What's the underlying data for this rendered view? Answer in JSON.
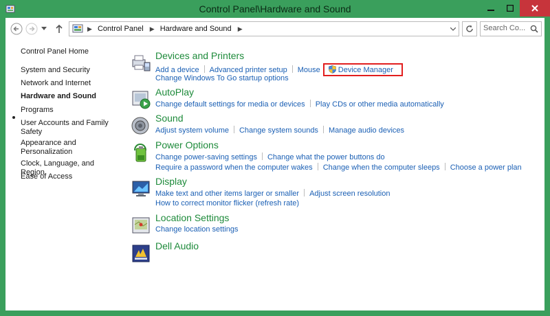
{
  "window": {
    "title": "Control Panel\\Hardware and Sound"
  },
  "address": {
    "crumbs": [
      "Control Panel",
      "Hardware and Sound"
    ]
  },
  "search": {
    "placeholder": "Search Co..."
  },
  "leftnav": {
    "home": "Control Panel Home",
    "items": [
      {
        "label": "System and Security"
      },
      {
        "label": "Network and Internet"
      },
      {
        "label": "Hardware and Sound",
        "current": true
      },
      {
        "label": "Programs"
      },
      {
        "label": "User Accounts and Family Safety"
      },
      {
        "label": "Appearance and Personalization"
      },
      {
        "label": "Clock, Language, and Region"
      },
      {
        "label": "Ease of Access"
      }
    ]
  },
  "categories": {
    "devices": {
      "title": "Devices and Printers",
      "links": [
        "Add a device",
        "Advanced printer setup",
        "Mouse",
        "Device Manager",
        "Change Windows To Go startup options"
      ]
    },
    "autoplay": {
      "title": "AutoPlay",
      "links": [
        "Change default settings for media or devices",
        "Play CDs or other media automatically"
      ]
    },
    "sound": {
      "title": "Sound",
      "links": [
        "Adjust system volume",
        "Change system sounds",
        "Manage audio devices"
      ]
    },
    "power": {
      "title": "Power Options",
      "links": [
        "Change power-saving settings",
        "Change what the power buttons do",
        "Require a password when the computer wakes",
        "Change when the computer sleeps",
        "Choose a power plan"
      ]
    },
    "display": {
      "title": "Display",
      "links": [
        "Make text and other items larger or smaller",
        "Adjust screen resolution",
        "How to correct monitor flicker (refresh rate)"
      ]
    },
    "location": {
      "title": "Location Settings",
      "links": [
        "Change location settings"
      ]
    },
    "dell": {
      "title": "Dell Audio"
    }
  },
  "colors": {
    "title_bar": "#3a9f5c",
    "close_button": "#c7343b",
    "link": "#1a5fb4",
    "category_title": "#1d8a3a",
    "highlight_box": "#e21e1e"
  }
}
